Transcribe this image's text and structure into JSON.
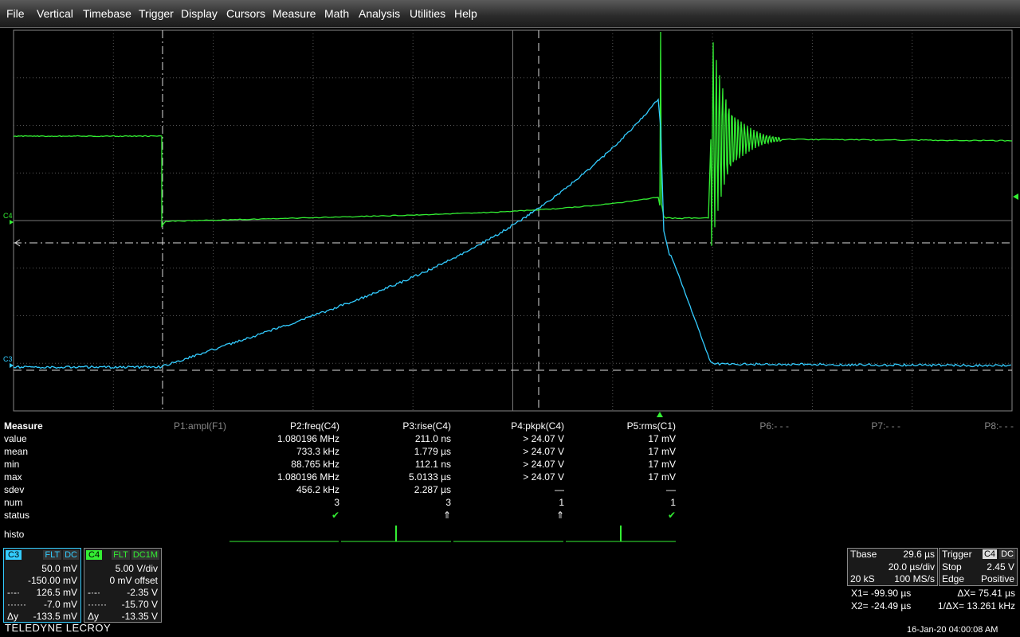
{
  "menu": [
    "File",
    "Vertical",
    "Timebase",
    "Trigger",
    "Display",
    "Cursors",
    "Measure",
    "Math",
    "Analysis",
    "Utilities",
    "Help"
  ],
  "grid_labels": {
    "c4": "C4",
    "c3": "C3"
  },
  "colors": {
    "c3": "#33ccff",
    "c4": "#33ee33",
    "grid": "#555555",
    "background": "#000000",
    "panel": "#1a1a1a"
  },
  "measure": {
    "title": "Measure",
    "rows": [
      "value",
      "mean",
      "min",
      "max",
      "sdev",
      "num",
      "status"
    ],
    "histo_label": "histo",
    "columns": [
      {
        "header": "P1:ampl(F1)",
        "active": false,
        "values": [
          "",
          "",
          "",
          "",
          "",
          "",
          ""
        ]
      },
      {
        "header": "P2:freq(C4)",
        "active": true,
        "values": [
          "1.080196 MHz",
          "733.3 kHz",
          "88.765 kHz",
          "1.080196 MHz",
          "456.2 kHz",
          "3",
          "✔"
        ]
      },
      {
        "header": "P3:rise(C4)",
        "active": true,
        "values": [
          "211.0 ns",
          "1.779 µs",
          "112.1 ns",
          "5.0133 µs",
          "2.287 µs",
          "3",
          "⇑"
        ]
      },
      {
        "header": "P4:pkpk(C4)",
        "active": true,
        "values": [
          "> 24.07 V",
          "> 24.07 V",
          "> 24.07 V",
          "> 24.07 V",
          "—",
          "1",
          "⇑"
        ]
      },
      {
        "header": "P5:rms(C1)",
        "active": true,
        "values": [
          "17 mV",
          "17 mV",
          "17 mV",
          "17 mV",
          "—",
          "1",
          "✔"
        ]
      },
      {
        "header": "P6:- - -",
        "active": false,
        "values": [
          "",
          "",
          "",
          "",
          "",
          "",
          ""
        ]
      },
      {
        "header": "P7:- - -",
        "active": false,
        "values": [
          "",
          "",
          "",
          "",
          "",
          "",
          ""
        ]
      },
      {
        "header": "P8:- - -",
        "active": false,
        "values": [
          "",
          "",
          "",
          "",
          "",
          "",
          ""
        ]
      }
    ]
  },
  "ch3": {
    "tag": "C3",
    "flags": [
      "FLT",
      "DC"
    ],
    "vdiv": "50.0 mV",
    "offset": "-150.00 mV",
    "cur1": "126.5 mV",
    "cur2": "-7.0 mV",
    "dy_label": "Δy",
    "dy": "-133.5 mV"
  },
  "ch4": {
    "tag": "C4",
    "flags": [
      "FLT",
      "DC1M"
    ],
    "vdiv": "5.00 V/div",
    "offset": "0 mV offset",
    "cur1": "-2.35 V",
    "cur2": "-15.70 V",
    "dy_label": "Δy",
    "dy": "-13.35 V"
  },
  "tbase": {
    "label": "Tbase",
    "delay": "29.6 µs",
    "tdiv": "20.0 µs/div",
    "samples": "20 kS",
    "rate": "100 MS/s"
  },
  "trigger": {
    "label": "Trigger",
    "src": "C4",
    "coupling": "DC",
    "mode": "Stop",
    "level": "2.45 V",
    "type": "Edge",
    "slope": "Positive"
  },
  "cursors": {
    "x1": "X1= -99.90 µs",
    "x2": "X2= -24.49 µs",
    "dx": "ΔX= 75.41 µs",
    "inv_dx": "1/ΔX= 13.261 kHz"
  },
  "brand": "TELEDYNE LECROY",
  "datetime": "16-Jan-20 04:00:08 AM"
}
